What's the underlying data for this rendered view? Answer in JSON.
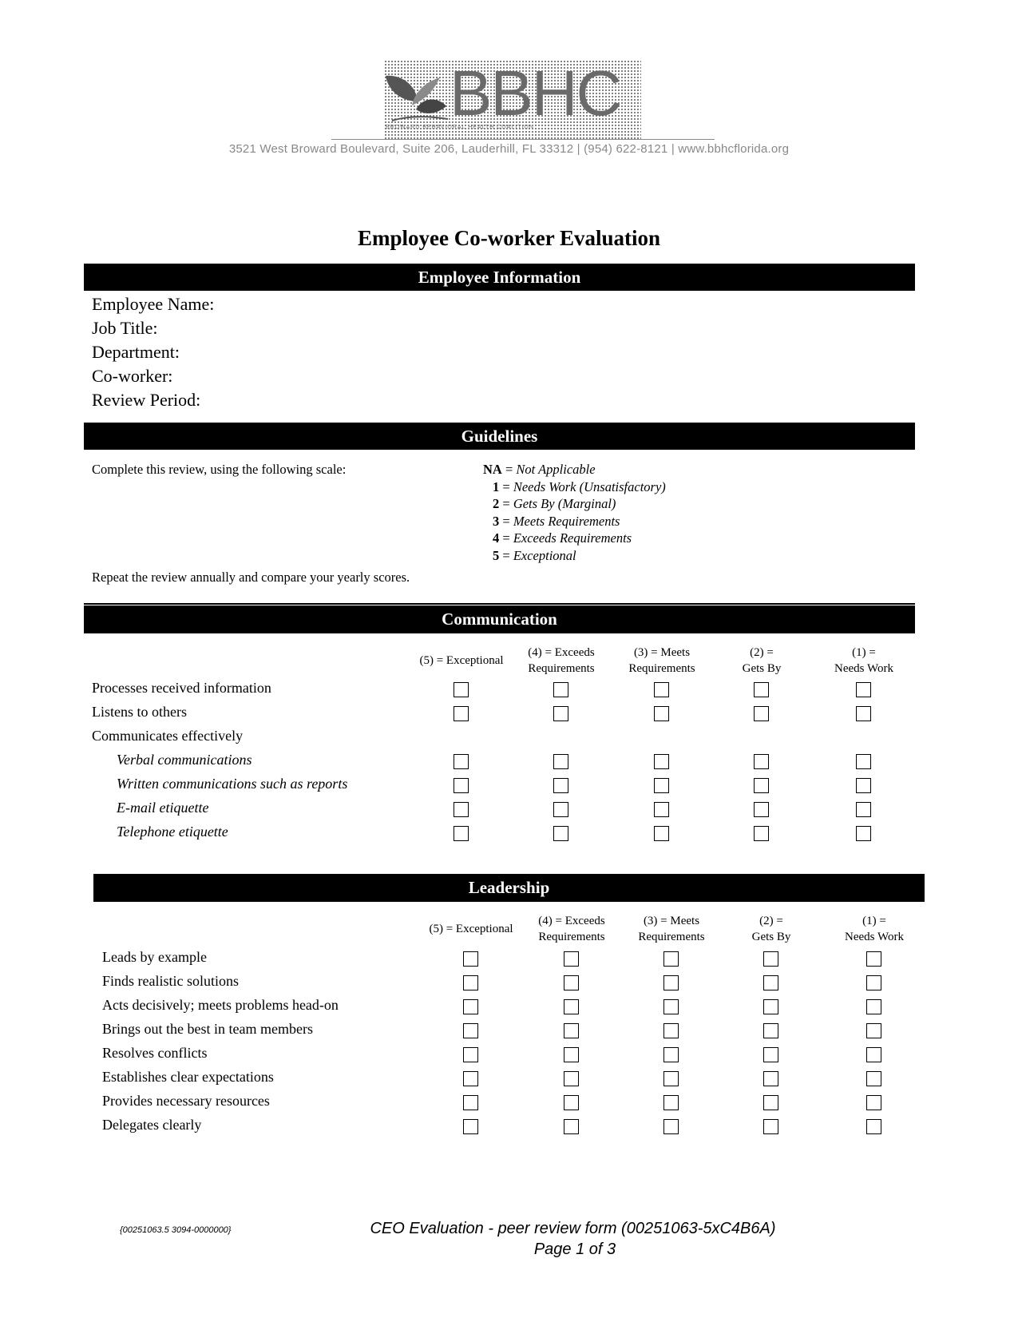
{
  "header": {
    "logo_text": "BBHC",
    "logo_subtitle": "BROWARD BEHAVIORAL HEALTH COALITION",
    "address": "3521 West Broward Boulevard,  Suite 206, Lauderhill, FL 33312 | (954) 622-8121 | www.bbhcflorida.org"
  },
  "title": "Employee Co-worker Evaluation",
  "employee_information": {
    "heading": "Employee Information",
    "fields": [
      {
        "label": "Employee Name:",
        "value": ""
      },
      {
        "label": "Job Title:",
        "value": ""
      },
      {
        "label": "Department:",
        "value": ""
      },
      {
        "label": "Co-worker:",
        "value": ""
      },
      {
        "label": "Review Period:",
        "value": ""
      }
    ]
  },
  "guidelines": {
    "heading": "Guidelines",
    "instruction": "Complete this review, using the following scale:",
    "scale": [
      {
        "key": "NA",
        "meaning": "Not Applicable"
      },
      {
        "key": "1",
        "meaning": "Needs Work (Unsatisfactory)"
      },
      {
        "key": "2",
        "meaning": "Gets By (Marginal)"
      },
      {
        "key": "3",
        "meaning": "Meets Requirements"
      },
      {
        "key": "4",
        "meaning": "Exceeds Requirements"
      },
      {
        "key": "5",
        "meaning": "Exceptional"
      }
    ],
    "repeat_note": "Repeat the review annually and compare your yearly scores."
  },
  "rating_columns": [
    {
      "line1": "(5) = Exceptional",
      "line2": ""
    },
    {
      "line1": "(4) = Exceeds",
      "line2": "Requirements"
    },
    {
      "line1": "(3) = Meets",
      "line2": "Requirements"
    },
    {
      "line1": "(2) =",
      "line2": "Gets By"
    },
    {
      "line1": "(1) =",
      "line2": "Needs Work"
    }
  ],
  "communication": {
    "heading": "Communication",
    "rows": [
      {
        "label": "Processes received information",
        "sub": false,
        "has_checkboxes": true,
        "checked": [
          false,
          false,
          false,
          false,
          false
        ]
      },
      {
        "label": "Listens to others",
        "sub": false,
        "has_checkboxes": true,
        "checked": [
          false,
          false,
          false,
          false,
          false
        ]
      },
      {
        "label": "Communicates effectively",
        "sub": false,
        "has_checkboxes": false,
        "checked": []
      },
      {
        "label": "Verbal communications",
        "sub": true,
        "has_checkboxes": true,
        "checked": [
          false,
          false,
          false,
          false,
          false
        ]
      },
      {
        "label": "Written communications such as reports",
        "sub": true,
        "has_checkboxes": true,
        "checked": [
          false,
          false,
          false,
          false,
          false
        ]
      },
      {
        "label": "E-mail etiquette",
        "sub": true,
        "has_checkboxes": true,
        "checked": [
          false,
          false,
          false,
          false,
          false
        ]
      },
      {
        "label": "Telephone etiquette",
        "sub": true,
        "has_checkboxes": true,
        "checked": [
          false,
          false,
          false,
          false,
          false
        ]
      }
    ]
  },
  "leadership": {
    "heading": "Leadership",
    "rows": [
      {
        "label": "Leads by example",
        "sub": false,
        "has_checkboxes": true,
        "checked": [
          false,
          false,
          false,
          false,
          false
        ]
      },
      {
        "label": "Finds realistic solutions",
        "sub": false,
        "has_checkboxes": true,
        "checked": [
          false,
          false,
          false,
          false,
          false
        ]
      },
      {
        "label": "Acts decisively; meets problems head-on",
        "sub": false,
        "has_checkboxes": true,
        "checked": [
          false,
          false,
          false,
          false,
          false
        ]
      },
      {
        "label": "Brings out the best in team members",
        "sub": false,
        "has_checkboxes": true,
        "checked": [
          false,
          false,
          false,
          false,
          false
        ]
      },
      {
        "label": "Resolves conflicts",
        "sub": false,
        "has_checkboxes": true,
        "checked": [
          false,
          false,
          false,
          false,
          false
        ]
      },
      {
        "label": "Establishes clear expectations",
        "sub": false,
        "has_checkboxes": true,
        "checked": [
          false,
          false,
          false,
          false,
          false
        ]
      },
      {
        "label": "Provides necessary resources",
        "sub": false,
        "has_checkboxes": true,
        "checked": [
          false,
          false,
          false,
          false,
          false
        ]
      },
      {
        "label": "Delegates clearly",
        "sub": false,
        "has_checkboxes": true,
        "checked": [
          false,
          false,
          false,
          false,
          false
        ]
      }
    ]
  },
  "footer": {
    "doc_id": "{00251063.5 3094-0000000}",
    "doc_title": "CEO Evaluation - peer review form (00251063-5xC4B6A)",
    "page": "Page 1 of 3"
  }
}
